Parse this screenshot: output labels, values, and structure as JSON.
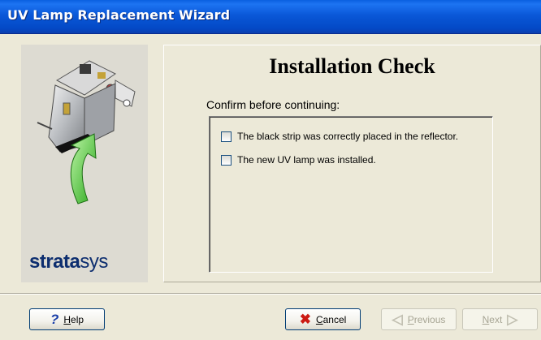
{
  "window": {
    "title": "UV Lamp Replacement Wizard"
  },
  "left_panel": {
    "logo_bold": "strata",
    "logo_light": "sys",
    "image": "uv-lamp-reflector-illustration"
  },
  "main": {
    "title": "Installation Check",
    "prompt": "Confirm before continuing:",
    "checks": [
      {
        "label": "The black strip was correctly placed in the reflector.",
        "checked": false
      },
      {
        "label": "The new UV lamp was installed.",
        "checked": false
      }
    ]
  },
  "buttons": {
    "help": {
      "glyph": "?",
      "mnemonic": "H",
      "rest": "elp",
      "icon": "help-icon"
    },
    "cancel": {
      "glyph": "✖",
      "mnemonic": "C",
      "rest": "ancel",
      "icon": "cancel-x-icon"
    },
    "previous": {
      "glyph": "◁",
      "mnemonic": "P",
      "rest": "revious",
      "enabled": false
    },
    "next": {
      "glyph": "▷",
      "mnemonic": "N",
      "rest": "ext",
      "enabled": false
    }
  },
  "colors": {
    "titlebar": "#0a58d8",
    "panel": "#ece9d8",
    "logo": "#0d2e6f",
    "arrow": "#3fcc2a",
    "cancel_icon": "#cc1a12"
  }
}
